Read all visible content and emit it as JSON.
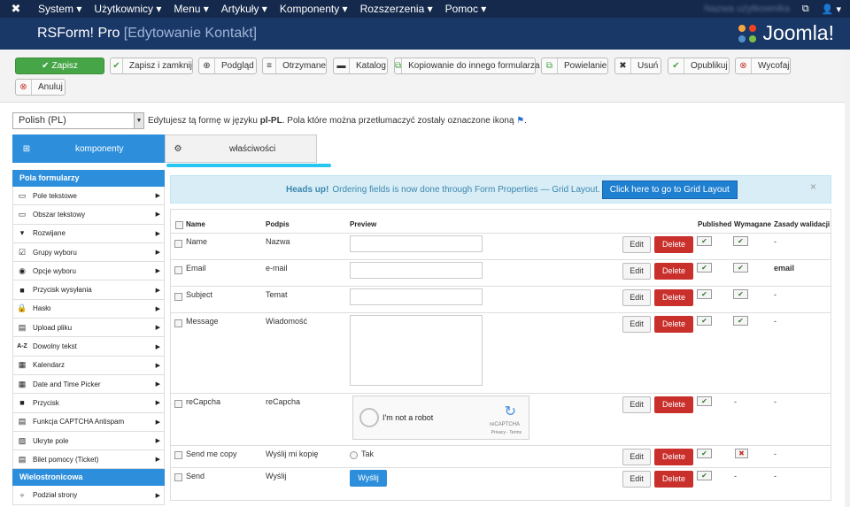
{
  "topbar": {
    "menu": [
      "System ▾",
      "Użytkownicy ▾",
      "Menu ▾",
      "Artykuły ▾",
      "Komponenty ▾",
      "Rozszerzenia ▾",
      "Pomoc ▾"
    ],
    "user_name": "Nazwa użytkownika",
    "external_icon": "⧉",
    "user_icon": "👤 ▾"
  },
  "header": {
    "title": "RSForm! Pro",
    "subtitle": "[Edytowanie Kontakt]",
    "brand": "Joomla!"
  },
  "toolbar": {
    "buttons": [
      {
        "icon": "✔",
        "label": "Zapisz"
      },
      {
        "icon": "✔",
        "label": "Zapisz i zamknij"
      },
      {
        "icon": "⊕",
        "label": "Podgląd"
      },
      {
        "icon": "≡",
        "label": "Otrzymane"
      },
      {
        "icon": "▬",
        "label": "Katalog"
      },
      {
        "icon": "⧉",
        "label": "Kopiowanie do innego formularza"
      },
      {
        "icon": "⧉",
        "label": "Powielanie"
      },
      {
        "icon": "✖",
        "label": "Usuń"
      },
      {
        "icon": "✔",
        "label": "Opublikuj"
      },
      {
        "icon": "⊗",
        "label": "Wycofaj"
      },
      {
        "icon": "⊗",
        "label": "Anuluj"
      }
    ]
  },
  "lang": {
    "selected": "Polish (PL)",
    "message_pre": "Edytujesz tą formę w języku",
    "code": "pl-PL",
    "message_post": ". Pola które można przetłumaczyć zostały oznaczone ikoną",
    "end": "."
  },
  "tabs": [
    {
      "icon": "⊞",
      "label": "komponenty"
    },
    {
      "icon": "⚙",
      "label": "właściwości"
    }
  ],
  "sidebar": {
    "section1": "Pola formularzy",
    "items": [
      {
        "icon": "▭",
        "label": "Pole tekstowe"
      },
      {
        "icon": "▭",
        "label": "Obszar tekstowy"
      },
      {
        "icon": "▾",
        "label": "Rozwijane"
      },
      {
        "icon": "☑",
        "label": "Grupy wyboru"
      },
      {
        "icon": "◉",
        "label": "Opcje wyboru"
      },
      {
        "icon": "■",
        "label": "Przycisk wysyłania"
      },
      {
        "icon": "🔒",
        "label": "Hasło"
      },
      {
        "icon": "▤",
        "label": "Upload pliku"
      },
      {
        "icon": "A-Z",
        "label": "Dowolny tekst"
      },
      {
        "icon": "▦",
        "label": "Kalendarz"
      },
      {
        "icon": "▦",
        "label": "Date and Time Picker"
      },
      {
        "icon": "■",
        "label": "Przycisk"
      },
      {
        "icon": "▤",
        "label": "Funkcja CAPTCHA Antispam"
      },
      {
        "icon": "▨",
        "label": "Ukryte pole"
      },
      {
        "icon": "▤",
        "label": "Bilet pomocy (Ticket)"
      }
    ],
    "section2": "Wielostronicowa",
    "items2": [
      {
        "icon": "÷",
        "label": "Podział strony"
      }
    ]
  },
  "alert": {
    "bold": "Heads up!",
    "text": "Ordering fields is now done through Form Properties — Grid Layout.",
    "button": "Click here to go to Grid Layout",
    "close": "×"
  },
  "grid": {
    "headers": {
      "name": "Name",
      "caption": "Podpis",
      "preview": "Preview",
      "published": "Published",
      "required": "Wymagane",
      "validation": "Zasady walidacji"
    },
    "edit_label": "Edit",
    "delete_label": "Delete",
    "check": "✔",
    "cross": "✖",
    "dash": "-",
    "rows": [
      {
        "name": "Name",
        "caption": "Nazwa",
        "preview": "input",
        "published": true,
        "required": "yes",
        "validation": "-"
      },
      {
        "name": "Email",
        "caption": "e-mail",
        "preview": "input",
        "published": true,
        "required": "yes",
        "validation": "email"
      },
      {
        "name": "Subject",
        "caption": "Temat",
        "preview": "input",
        "published": true,
        "required": "yes",
        "validation": "-"
      },
      {
        "name": "Message",
        "caption": "Wiadomość",
        "preview": "textarea",
        "published": true,
        "required": "yes",
        "validation": "-"
      },
      {
        "name": "reCapcha",
        "caption": "reCapcha",
        "preview": "recaptcha",
        "published": true,
        "required": "none",
        "validation": "-"
      },
      {
        "name": "Send me copy",
        "caption": "Wyślij mi kopię",
        "preview": "radio",
        "published": true,
        "required": "no",
        "validation": "-"
      },
      {
        "name": "Send",
        "caption": "Wyślij",
        "preview": "button",
        "published": true,
        "required": "none",
        "validation": "-"
      }
    ],
    "recaptcha_text": "I'm not a robot",
    "recaptcha_brand": "reCAPTCHA",
    "recaptcha_links": "Privacy - Terms",
    "radio_label": "Tak",
    "send_button": "Wyślij"
  },
  "colors": {
    "topbar": "#14294c",
    "header": "#1a3867",
    "primary": "#2d8fdc",
    "save": "#46a546",
    "delete": "#c9302c",
    "alert_bg": "#d9edf7"
  }
}
